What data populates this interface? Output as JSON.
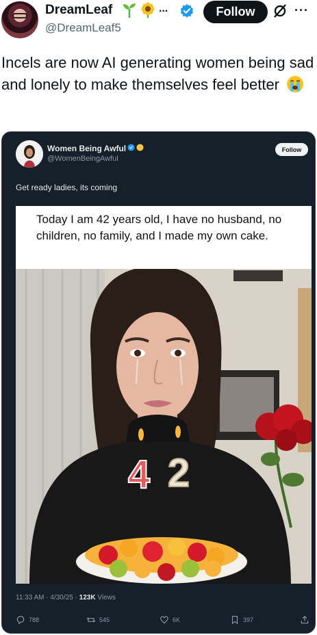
{
  "outer_tweet": {
    "display_name": "DreamLeaf",
    "handle": "@DreamLeaf5",
    "badge_ellipsis": "...",
    "follow_label": "Follow",
    "more_label": "···",
    "text": "Incels are now AI generating women being sad and lonely to make themselves feel better"
  },
  "quoted_tweet": {
    "display_name": "Women Being Awful",
    "handle": "@WomenBeingAwful",
    "follow_label": "Follow",
    "text": "Get ready ladies, its coming",
    "image_caption": "Today I am 42 years old, I have no husband, no children, no family, and I made my own cake.",
    "candle_digits": [
      "4",
      "2"
    ],
    "time": "11:33 AM",
    "date": "4/30/25",
    "views_count": "123K",
    "views_label": "Views",
    "replies": "788",
    "reposts": "545",
    "likes": "6K",
    "bookmarks": "397"
  },
  "colors": {
    "card_bg": "#15202b",
    "verified_blue": "#1d9bf0",
    "gold_badge": "#f4c542"
  },
  "icons": [
    "verified-icon",
    "sprout-icon",
    "sunflower-icon",
    "grok-icon",
    "more-icon",
    "crying-face-emoji",
    "reply-icon",
    "repost-icon",
    "like-icon",
    "bookmark-icon",
    "share-icon"
  ]
}
